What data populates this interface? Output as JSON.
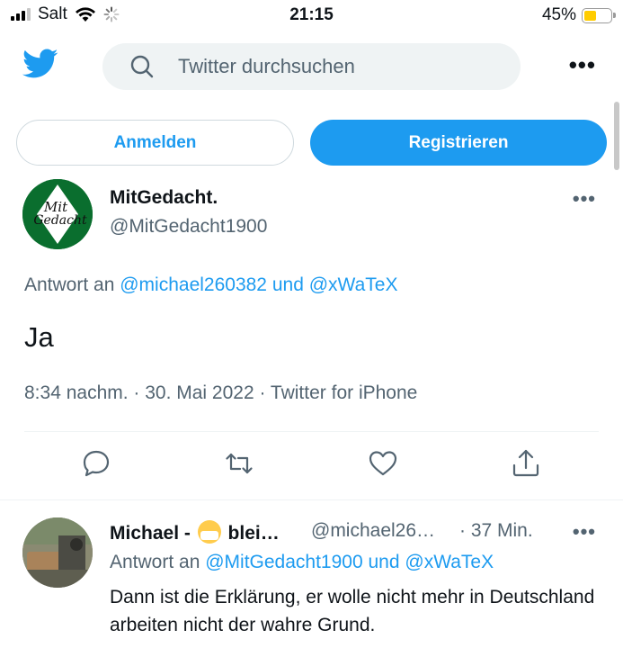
{
  "status_bar": {
    "carrier": "Salt",
    "time": "21:15",
    "battery": "45%",
    "battery_level": 0.45
  },
  "header": {
    "search_placeholder": "Twitter durchsuchen",
    "more": "•••"
  },
  "auth": {
    "login": "Anmelden",
    "register": "Registrieren"
  },
  "tweet": {
    "avatar_text_line1": "Mit",
    "avatar_text_line2": "Gedacht",
    "display_name": "MitGedacht.",
    "handle": "@MitGedacht1900",
    "more": "•••",
    "reply_prefix": "Antwort an",
    "reply_user1": "@michael260382",
    "reply_and": "und",
    "reply_user2": "@xWaTeX",
    "text": "Ja",
    "meta": "8:34 nachm. · 30. Mai 2022 · Twitter for iPhone"
  },
  "reply": {
    "display_name_start": "Michael -",
    "display_name_end": "blei…",
    "handle": "@michael26…",
    "time": "· 37 Min.",
    "more": "•••",
    "reply_prefix": "Antwort an",
    "reply_user1": "@MitGedacht1900",
    "reply_and": "und",
    "reply_user2": "@xWaTeX",
    "text": "Dann ist die Erklärung, er wolle nicht mehr in Deutschland arbeiten nicht der wahre Grund."
  },
  "colors": {
    "accent": "#1d9bf0",
    "muted": "#536471",
    "search_bg": "#eff3f4"
  }
}
